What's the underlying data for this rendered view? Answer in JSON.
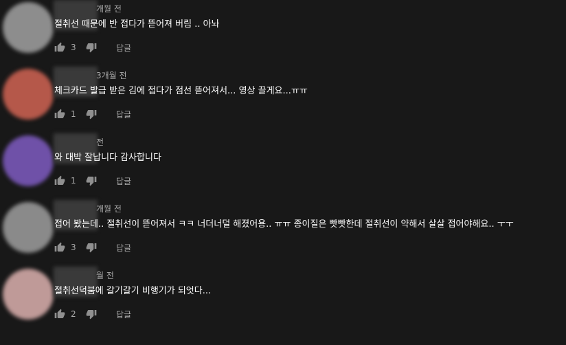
{
  "comments": [
    {
      "time": "개월 전",
      "text": "절취선 때문에 반 접다가 뜯어져 버림 .. 아놔",
      "likes": "3",
      "reply": "답글",
      "avatar_color": "#8d8d8d"
    },
    {
      "time": "3개월 전",
      "text": "체크카드 발급 받은 김에 접다가 점선 뜯어져서... 영상 끌게요...ㅠㅠ",
      "likes": "1",
      "reply": "답글",
      "avatar_color": "#b5584a"
    },
    {
      "time": "전",
      "text": "와 대박 잘납니다 감사합니다",
      "likes": "1",
      "reply": "답글",
      "avatar_color": "#6f51a8"
    },
    {
      "time": "개월 전",
      "text": "접어 봤는데.. 절취선이 뜯어져서 ㅋㅋ 너더너덜 해졌어용..  ㅠㅠ 종이질은 빳빳한데 절취선이 약해서 살살 접어야해요.. ㅜㅜ",
      "likes": "3",
      "reply": "답글",
      "avatar_color": "#8a8a8a"
    },
    {
      "time": "월 전",
      "text": "절취선덕붐에 갈기갈기 비행기가 되엇다...",
      "likes": "2",
      "reply": "답글",
      "avatar_color": "#bf9a98"
    }
  ]
}
